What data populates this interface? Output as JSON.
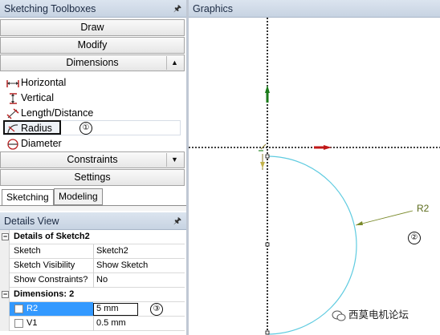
{
  "toolbox": {
    "title": "Sketching Toolboxes",
    "sections": {
      "draw": "Draw",
      "modify": "Modify",
      "dimensions": "Dimensions",
      "constraints": "Constraints",
      "settings": "Settings"
    },
    "tools": [
      "Horizontal",
      "Vertical",
      "Length/Distance",
      "Radius",
      "Diameter"
    ],
    "tabs": [
      "Sketching",
      "Modeling"
    ]
  },
  "annotations": {
    "n1": "①",
    "n2": "②",
    "n3": "③"
  },
  "details": {
    "title": "Details View",
    "group_sketch": "Details of Sketch2",
    "rows": [
      {
        "label": "Sketch",
        "value": "Sketch2"
      },
      {
        "label": "Sketch Visibility",
        "value": "Show Sketch"
      },
      {
        "label": "Show Constraints?",
        "value": "No"
      }
    ],
    "group_dims": "Dimensions: 2",
    "dims": [
      {
        "label": "R2",
        "value": "5 mm"
      },
      {
        "label": "V1",
        "value": "0.5 mm"
      }
    ]
  },
  "graphics": {
    "title": "Graphics",
    "dim_label": "R2"
  },
  "watermark": "西莫电机论坛"
}
